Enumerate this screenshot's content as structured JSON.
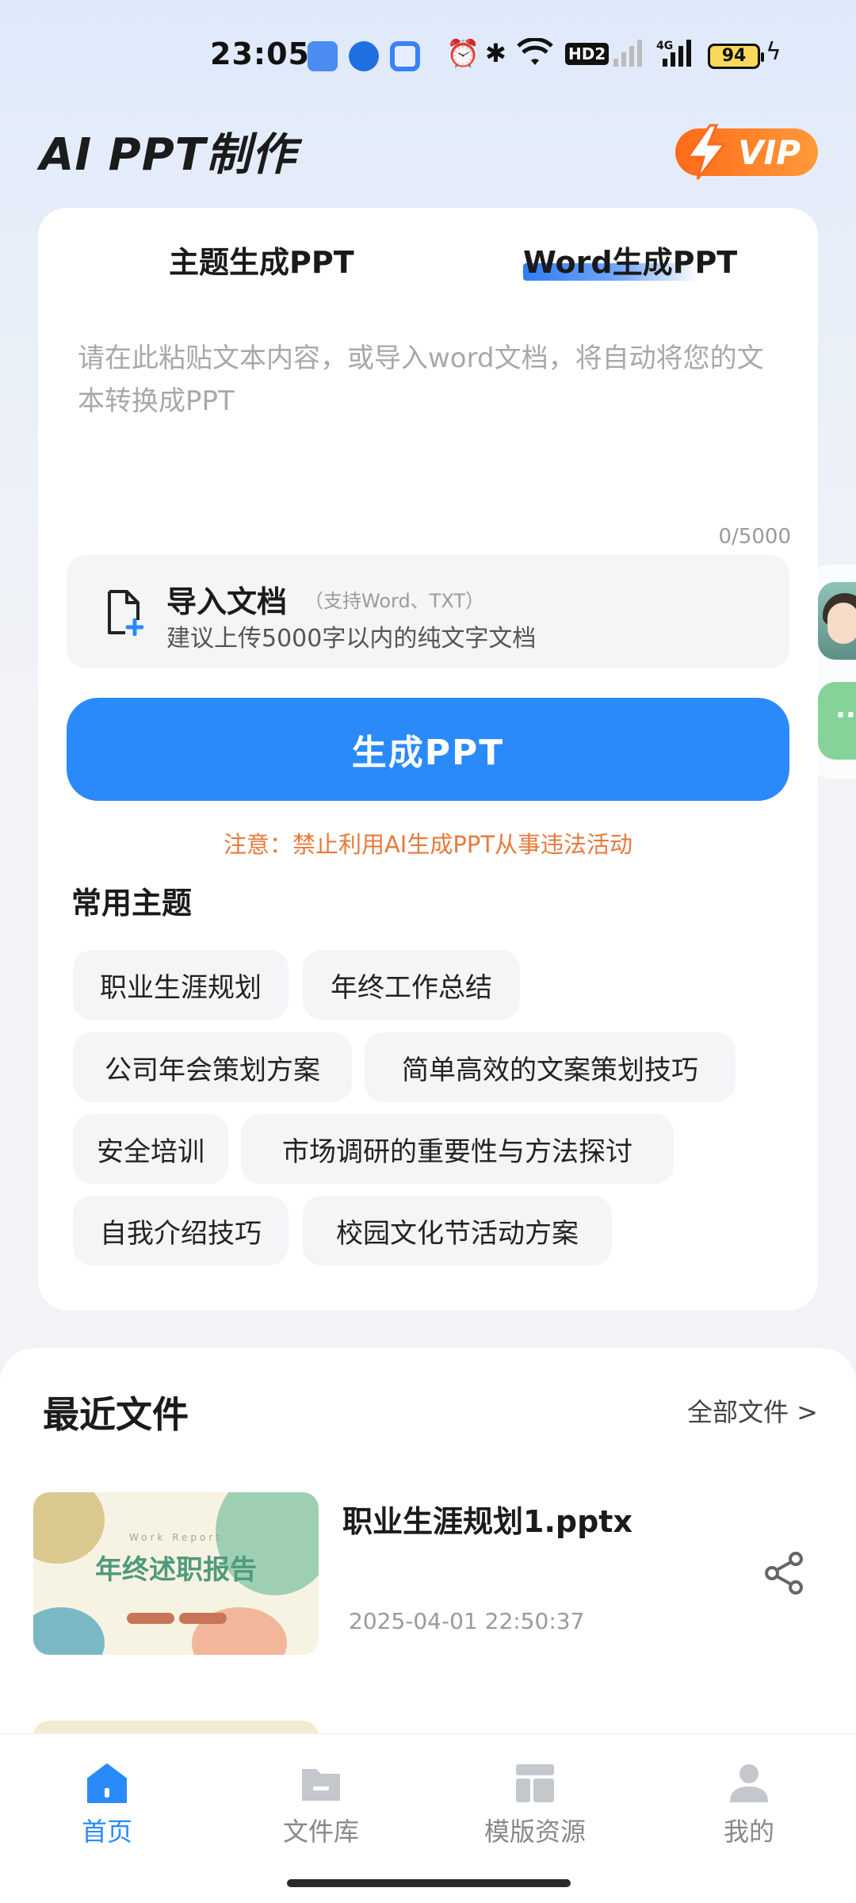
{
  "status_bar": {
    "time": "23:05",
    "battery": "94",
    "network": "4G",
    "hd": "HD2"
  },
  "header": {
    "title": "AI PPT制作",
    "vip_label": "VIP"
  },
  "tabs": [
    {
      "label": "主题生成PPT"
    },
    {
      "label": "Word生成PPT"
    }
  ],
  "editor": {
    "placeholder": "请在此粘贴文本内容，或导入word文档，将自动将您的文本转换成PPT",
    "value": "",
    "char_count": "0/5000"
  },
  "import": {
    "title": "导入文档",
    "support": "（支持Word、TXT）",
    "desc": "建议上传5000字以内的纯文字文档"
  },
  "generate_button": "生成PPT",
  "warning": "注意：禁止利用AI生成PPT从事违法活动",
  "topics": {
    "title": "常用主题",
    "items": [
      "职业生涯规划",
      "年终工作总结",
      "公司年会策划方案",
      "简单高效的文案策划技巧",
      "安全培训",
      "市场调研的重要性与方法探讨",
      "自我介绍技巧",
      "校园文化节活动方案"
    ]
  },
  "recent": {
    "title": "最近文件",
    "all_files": "全部文件 >",
    "files": [
      {
        "name": "职业生涯规划1.pptx",
        "time": "2025-04-01 22:50:37",
        "thumb_title": "年终述职报告",
        "thumb_en": "Work Report"
      }
    ]
  },
  "nav": [
    {
      "label": "首页",
      "icon": "home-icon",
      "active": true
    },
    {
      "label": "文件库",
      "icon": "folder-icon",
      "active": false
    },
    {
      "label": "模版资源",
      "icon": "template-icon",
      "active": false
    },
    {
      "label": "我的",
      "icon": "user-icon",
      "active": false
    }
  ],
  "colors": {
    "primary": "#2a8afa",
    "warning": "#e8793a",
    "vip": "#ff7a22"
  }
}
